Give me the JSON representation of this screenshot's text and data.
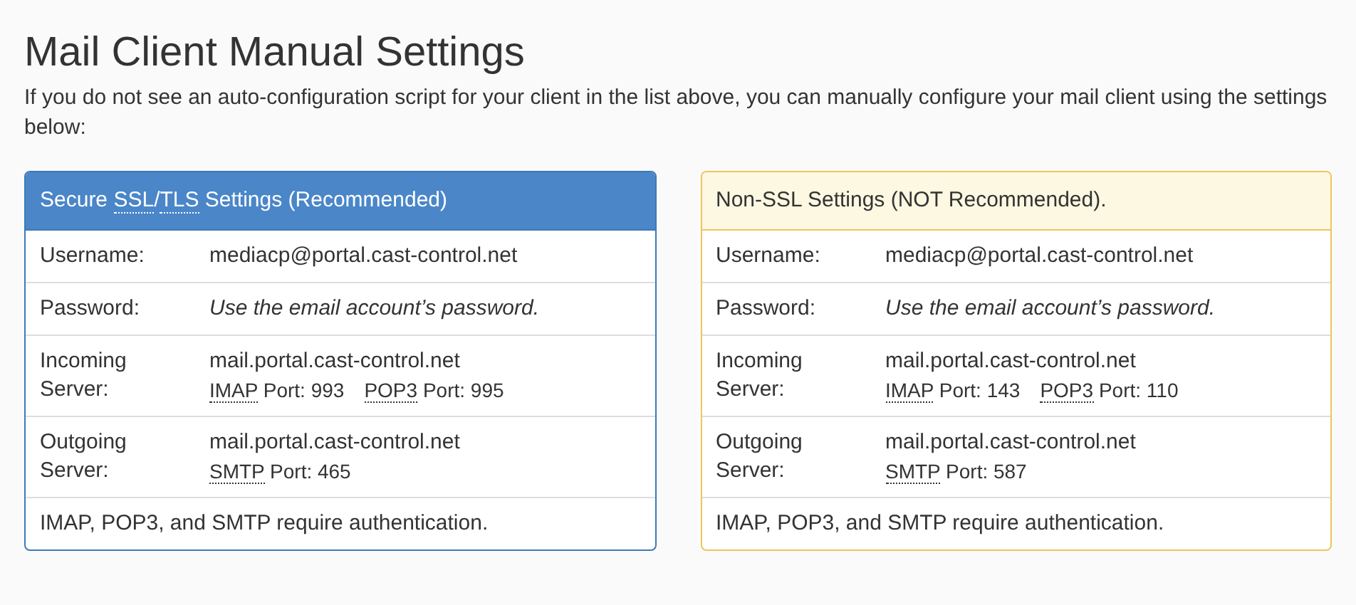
{
  "heading": "Mail Client Manual Settings",
  "intro": "If you do not see an auto-configuration script for your client in the list above, you can manually configure your mail client using the settings below:",
  "panels": [
    {
      "kind": "secure",
      "title": [
        {
          "text": "Secure "
        },
        {
          "text": "SSL",
          "abbr": true
        },
        {
          "text": "/"
        },
        {
          "text": "TLS",
          "abbr": true
        },
        {
          "text": " Settings (Recommended)"
        }
      ],
      "rows": [
        {
          "kind": "text",
          "label": "Username:",
          "value": "mediacp@portal.cast-control.net"
        },
        {
          "kind": "note",
          "label": "Password:",
          "value": "Use the email account’s password."
        },
        {
          "kind": "server",
          "label": "Incoming Server:",
          "value": "mail.portal.cast-control.net",
          "ports": [
            {
              "protocol": "IMAP",
              "port": "Port: 993"
            },
            {
              "protocol": "POP3",
              "port": "Port: 995"
            }
          ]
        },
        {
          "kind": "server",
          "label": "Outgoing Server:",
          "value": "mail.portal.cast-control.net",
          "ports": [
            {
              "protocol": "SMTP",
              "port": "Port: 465"
            }
          ]
        }
      ],
      "footer": "IMAP, POP3, and SMTP require authentication."
    },
    {
      "kind": "insecure",
      "title": [
        {
          "text": "Non-SSL Settings (NOT Recommended)."
        }
      ],
      "rows": [
        {
          "kind": "text",
          "label": "Username:",
          "value": "mediacp@portal.cast-control.net"
        },
        {
          "kind": "note",
          "label": "Password:",
          "value": "Use the email account’s password."
        },
        {
          "kind": "server",
          "label": "Incoming Server:",
          "value": "mail.portal.cast-control.net",
          "ports": [
            {
              "protocol": "IMAP",
              "port": "Port: 143"
            },
            {
              "protocol": "POP3",
              "port": "Port: 110"
            }
          ]
        },
        {
          "kind": "server",
          "label": "Outgoing Server:",
          "value": "mail.portal.cast-control.net",
          "ports": [
            {
              "protocol": "SMTP",
              "port": "Port: 587"
            }
          ]
        }
      ],
      "footer": "IMAP, POP3, and SMTP require authentication."
    }
  ]
}
